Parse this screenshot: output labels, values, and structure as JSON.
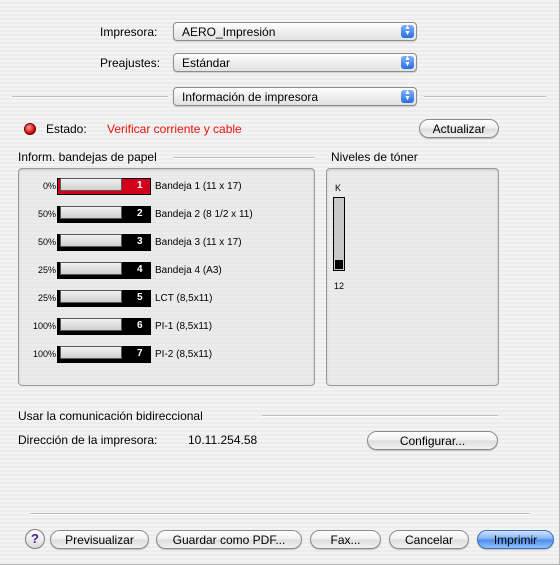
{
  "header": {
    "printer_label": "Impresora:",
    "printer_value": "AERO_Impresión",
    "presets_label": "Preajustes:",
    "presets_value": "Estándar",
    "panel_value": "Información de impresora"
  },
  "status": {
    "label": "Estado:",
    "message": "Verificar corriente y cable",
    "message_color": "#e8120c",
    "refresh_button": "Actualizar"
  },
  "trays": {
    "title": "Inform. bandejas de papel",
    "items": [
      {
        "percent": "0%",
        "number": "1",
        "name": "Bandeja 1 (11 x 17)",
        "level": 0,
        "highlight": true
      },
      {
        "percent": "50%",
        "number": "2",
        "name": "Bandeja 2 (8 1/2 x 11)",
        "level": 50,
        "highlight": false
      },
      {
        "percent": "50%",
        "number": "3",
        "name": "Bandeja 3 (11 x 17)",
        "level": 50,
        "highlight": false
      },
      {
        "percent": "25%",
        "number": "4",
        "name": "Bandeja 4 (A3)",
        "level": 25,
        "highlight": false
      },
      {
        "percent": "25%",
        "number": "5",
        "name": "LCT (8,5x11)",
        "level": 25,
        "highlight": false
      },
      {
        "percent": "100%",
        "number": "6",
        "name": "PI-1 (8,5x11)",
        "level": 100,
        "highlight": false
      },
      {
        "percent": "100%",
        "number": "7",
        "name": "PI-2 (8,5x11)",
        "level": 100,
        "highlight": false
      }
    ]
  },
  "toner": {
    "title": "Niveles de tóner",
    "color_label": "K",
    "value": "12",
    "level": 12
  },
  "bidirectional": {
    "title": "Usar la comunicación bidireccional",
    "address_label": "Dirección de la impresora:",
    "address_value": "10.11.254.58",
    "configure_button": "Configurar..."
  },
  "footer": {
    "help": "?",
    "preview": "Previsualizar",
    "save_pdf": "Guardar como PDF...",
    "fax": "Fax...",
    "cancel": "Cancelar",
    "print": "Imprimir"
  },
  "colors": {
    "accent_blue": "#4a8ae8",
    "tray_alert_red": "#d0021b"
  }
}
